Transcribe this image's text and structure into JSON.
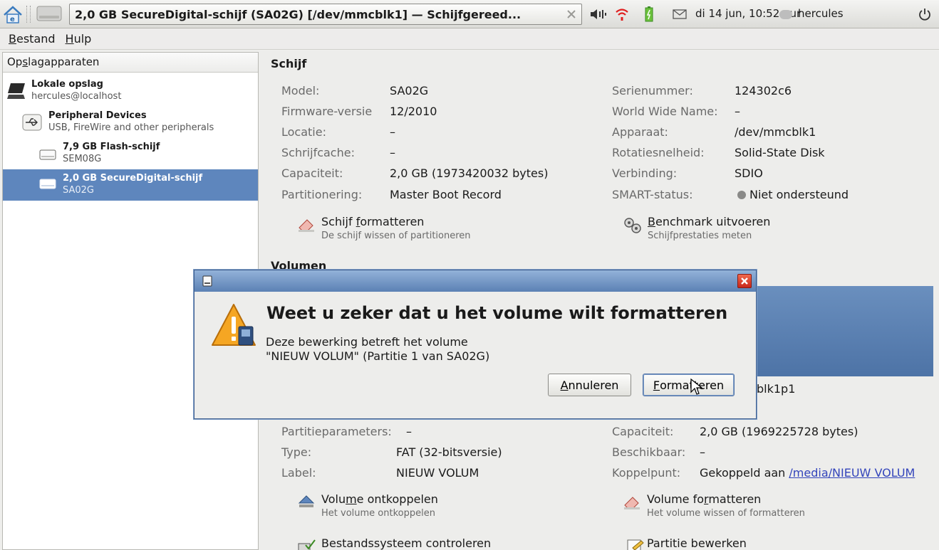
{
  "topbar": {
    "window_title": "2,0 GB SecureDigital-schijf (SA02G) [/dev/mmcblk1] — Schijfgereed...",
    "clock": "di 14 jun, 10:52 uur",
    "user": "hercules"
  },
  "menu": {
    "file": "estand",
    "file_accel": "B",
    "help": "ulp",
    "help_accel": "H"
  },
  "sidebar": {
    "header_pre": "Op",
    "header_accel": "s",
    "header_post": "lagapparaten",
    "items": [
      {
        "title": "Lokale opslag",
        "subtitle": "hercules@localhost"
      },
      {
        "title": "Peripheral Devices",
        "subtitle": "USB, FireWire and other peripherals"
      },
      {
        "title": "7,9 GB Flash-schijf",
        "subtitle": "SEM08G"
      },
      {
        "title": "2,0 GB SecureDigital-schijf",
        "subtitle": "SA02G"
      }
    ]
  },
  "disk": {
    "heading": "Schijf",
    "left": [
      {
        "label": "Model:",
        "value": "SA02G"
      },
      {
        "label": "Firmware-versie",
        "value": "12/2010"
      },
      {
        "label": "Locatie:",
        "value": "–"
      },
      {
        "label": "Schrijfcache:",
        "value": "–"
      },
      {
        "label": "Capaciteit:",
        "value": "2,0 GB (1973420032 bytes)"
      },
      {
        "label": "Partitionering:",
        "value": "Master Boot Record"
      }
    ],
    "right": [
      {
        "label": "Serienummer:",
        "value": "124302c6"
      },
      {
        "label": "World Wide Name:",
        "value": "–"
      },
      {
        "label": "Apparaat:",
        "value": "/dev/mmcblk1"
      },
      {
        "label": "Rotatiesnelheid:",
        "value": "Solid-State Disk"
      },
      {
        "label": "Verbinding:",
        "value": "SDIO"
      },
      {
        "label": "SMART-status:",
        "value": "Niet ondersteund"
      }
    ],
    "action_format_title_pre": "Schijf ",
    "action_format_accel": "f",
    "action_format_title_post": "ormatteren",
    "action_format_sub": "De schijf wissen of partitioneren",
    "action_bench_accel": "B",
    "action_bench_title_post": "enchmark uitvoeren",
    "action_bench_sub": "Schijfprestaties meten"
  },
  "volume": {
    "heading": "Volumen",
    "device_partial": "blk1p1",
    "left": [
      {
        "label": "Partitieparameters:",
        "value": "–"
      },
      {
        "label": "Type:",
        "value": "FAT (32-bitsversie)"
      },
      {
        "label": "Label:",
        "value": "NIEUW VOLUM"
      }
    ],
    "right": [
      {
        "label": "Capaciteit:",
        "value": "2,0 GB (1969225728 bytes)"
      },
      {
        "label": "Beschikbaar:",
        "value": "–"
      },
      {
        "label": "Koppelpunt:",
        "value_prefix": "Gekoppeld aan ",
        "link": "/media/NIEUW VOLUM"
      }
    ],
    "action_unmount_pre": "Volu",
    "action_unmount_accel": "m",
    "action_unmount_post": "e ontkoppelen",
    "action_unmount_sub": "Het volume ontkoppelen",
    "action_vformat_pre": "Volume fo",
    "action_vformat_accel": "r",
    "action_vformat_post": "matteren",
    "action_vformat_sub": "Het volume wissen of formatteren",
    "action_check": "Bestandssysteem controleren",
    "action_edit": "Partitie bewerken"
  },
  "dialog": {
    "heading": "Weet u zeker dat u het volume wilt formatteren",
    "body_line1": "Deze bewerking betreft het volume",
    "body_line2": "\"NIEUW VOLUM\" (Partitie 1 van SA02G)",
    "cancel_accel": "A",
    "cancel_post": "nnuleren",
    "format_accel": "F",
    "format_post": "ormatteren"
  },
  "colors": {
    "selection": "#5e86bd",
    "dialog_titlebar": "#5b81b4",
    "link": "#3344bb"
  }
}
